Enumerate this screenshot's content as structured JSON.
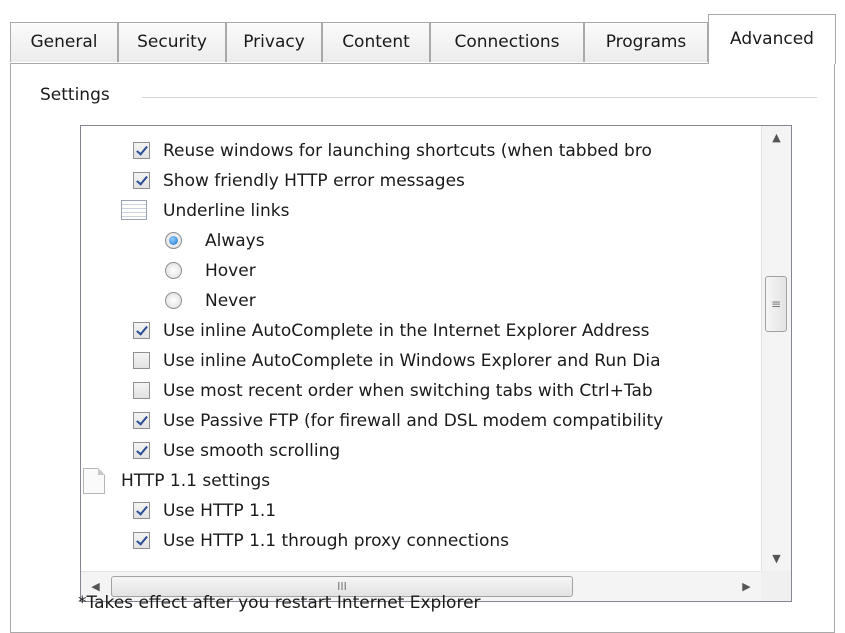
{
  "tabs": [
    {
      "label": "General"
    },
    {
      "label": "Security"
    },
    {
      "label": "Privacy"
    },
    {
      "label": "Content"
    },
    {
      "label": "Connections"
    },
    {
      "label": "Programs"
    },
    {
      "label": "Advanced",
      "active": true
    }
  ],
  "settings_group": {
    "label": "Settings"
  },
  "items": [
    {
      "type": "checkbox",
      "checked": true,
      "label": "Reuse windows for launching shortcuts (when tabbed bro"
    },
    {
      "type": "checkbox",
      "checked": true,
      "label": "Show friendly HTTP error messages"
    },
    {
      "type": "group",
      "icon": "group-icon",
      "label": "Underline links"
    },
    {
      "type": "radio",
      "selected": true,
      "label": "Always"
    },
    {
      "type": "radio",
      "selected": false,
      "label": "Hover"
    },
    {
      "type": "radio",
      "selected": false,
      "label": "Never"
    },
    {
      "type": "checkbox",
      "checked": true,
      "label": "Use inline AutoComplete in the Internet Explorer Address"
    },
    {
      "type": "checkbox",
      "checked": false,
      "label": "Use inline AutoComplete in Windows Explorer and Run Dia"
    },
    {
      "type": "checkbox",
      "checked": false,
      "label": "Use most recent order when switching tabs with Ctrl+Tab"
    },
    {
      "type": "checkbox",
      "checked": true,
      "label": "Use Passive FTP (for firewall and DSL modem compatibility"
    },
    {
      "type": "checkbox",
      "checked": true,
      "label": "Use smooth scrolling"
    },
    {
      "type": "group",
      "icon": "document-icon",
      "label": "HTTP 1.1 settings"
    },
    {
      "type": "checkbox",
      "checked": true,
      "label": "Use HTTP 1.1"
    },
    {
      "type": "checkbox",
      "checked": true,
      "label": "Use HTTP 1.1 through proxy connections"
    }
  ],
  "scrollbars": {
    "up_glyph": "▲",
    "down_glyph": "▼",
    "left_glyph": "◀",
    "right_glyph": "▶",
    "grip_glyph": "≡",
    "hgrip_glyph": "III"
  },
  "footnote": "*Takes effect after you restart Internet Explorer"
}
